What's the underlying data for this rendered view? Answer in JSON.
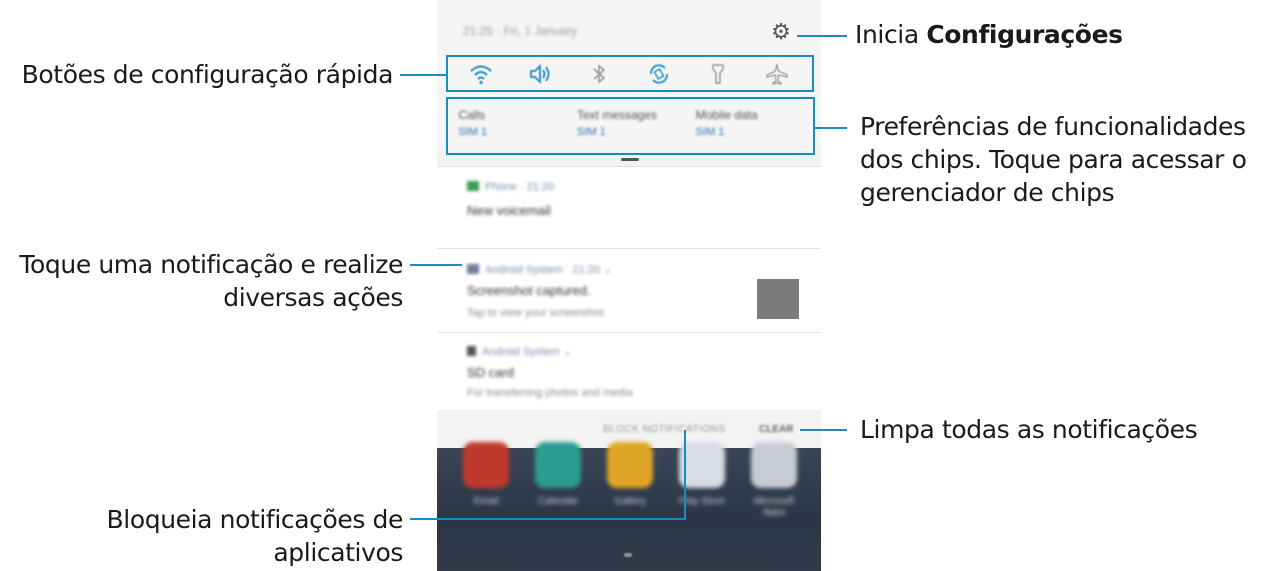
{
  "callouts": {
    "settings": {
      "prefix": "Inicia ",
      "bold": "Configurações"
    },
    "quick_buttons": "Botões de configuração rápida",
    "sim_prefs_1": "Preferências de funcionalidades",
    "sim_prefs_2": "dos chips. Toque para acessar o",
    "sim_prefs_3": "gerenciador de chips",
    "notification_1": "Toque uma notificação e realize",
    "notification_2": "diversas ações",
    "clear_all": "Limpa todas as notificações",
    "block_1": "Bloqueia notificações de",
    "block_2": "aplicativos"
  },
  "phone": {
    "status": "21:25 · Fri, 1 January",
    "quick_settings": [
      {
        "icon": "wifi-icon",
        "active": true
      },
      {
        "icon": "sound-icon",
        "active": true
      },
      {
        "icon": "bluetooth-icon",
        "active": false
      },
      {
        "icon": "auto-rotate-icon",
        "active": true
      },
      {
        "icon": "flashlight-icon",
        "active": false
      },
      {
        "icon": "airplane-icon",
        "active": false
      }
    ],
    "sim": [
      {
        "title": "Calls",
        "sub": "SIM 1"
      },
      {
        "title": "Text messages",
        "sub": "SIM 1"
      },
      {
        "title": "Mobile data",
        "sub": "SIM 1"
      }
    ],
    "notifications": [
      {
        "app": "Phone · 21:20",
        "title": "New voicemail",
        "sub": ""
      },
      {
        "app": "Android System · 21:20 ⌄",
        "title": "Screenshot captured.",
        "sub": "Tap to view your screenshot."
      },
      {
        "app": "Android System ⌄",
        "title": "SD card",
        "sub": "For transferring photos and media"
      }
    ],
    "block_label": "BLOCK NOTIFICATIONS",
    "clear_label": "CLEAR",
    "home_apps": [
      {
        "label": "Email",
        "color": "#c0392b"
      },
      {
        "label": "Calendar",
        "color": "#2a9d8f"
      },
      {
        "label": "Gallery",
        "color": "#e0a526"
      },
      {
        "label": "Play Store",
        "color": "#d8dde4"
      },
      {
        "label": "Microsoft Apps",
        "color": "#c7ccd4"
      }
    ],
    "accent_color": "#1d8bc0"
  }
}
